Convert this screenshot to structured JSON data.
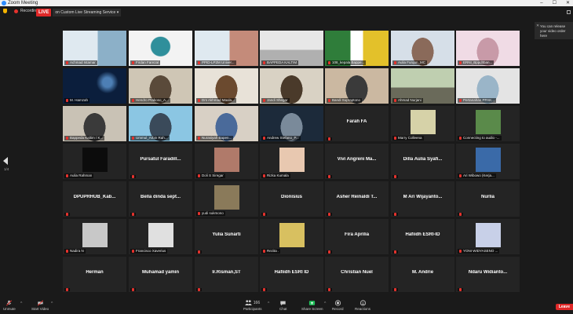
{
  "window": {
    "title": "Zoom Meeting",
    "min": "–",
    "max": "☐",
    "close": "✕"
  },
  "topbar": {
    "recording": "Recording",
    "live_badge": "LIVE",
    "live_service": "on Custom Live Streaming Service ▾"
  },
  "toast": {
    "close": "✕",
    "message": "You can release your video order here"
  },
  "pagination": {
    "indicator": "1/4"
  },
  "colors": {
    "active_speaker": "#b9e34a",
    "live": "#e02828",
    "tile_bg": "#242424",
    "share_green": "#21c35b"
  },
  "tiles": [
    {
      "label": "Achmad Istamar",
      "video": "slide",
      "c1": "#dfe9f0",
      "c2": "#8cb0c8",
      "active": true
    },
    {
      "label": "Firdan Farezal",
      "video": "logo",
      "c1": "#f3f3f3",
      "c2": "#2f8f9b"
    },
    {
      "label": "PPID-LP2M Univer...",
      "video": "slide",
      "c1": "#dfe9f0",
      "c2": "#c48b7a"
    },
    {
      "label": "BAPPEDA KALTIM",
      "video": "room",
      "c1": "#e7e7e7",
      "c2": "#b0b0b0"
    },
    {
      "label": "108_kepala Bappe...",
      "video": "banner",
      "c1": "#2f7d3a",
      "c2": "#e3c12a"
    },
    {
      "label": "Aulia Furqon_MC",
      "video": "person",
      "c1": "#d6dfe8",
      "c2": "#8a6a5a"
    },
    {
      "label": "ERNI_Bppdltban...",
      "video": "person",
      "c1": "#f0dbe5",
      "c2": "#c89aa8"
    },
    {
      "label": "M. Hamzah",
      "video": "space",
      "c1": "#0b1e3c",
      "c2": "#4d7fb5"
    },
    {
      "label": "Hendro Prakoso_A...",
      "video": "person",
      "c1": "#cfc6b5",
      "c2": "#5a4a3a"
    },
    {
      "label": "Drs Akhmad Maula...",
      "video": "person",
      "c1": "#e8e2d8",
      "c2": "#6b4a2f"
    },
    {
      "label": "Jandi Shegar",
      "video": "person",
      "c1": "#d9d2c4",
      "c2": "#4a3a2a"
    },
    {
      "label": "Bandi Supraptono",
      "video": "person",
      "c1": "#cbb8a1",
      "c2": "#3a3a3a"
    },
    {
      "label": "Ahmad Nurjani",
      "video": "room",
      "c1": "#bfcfb0",
      "c2": "#6a6a5a"
    },
    {
      "label": "Pertanahan PPAK...",
      "video": "person",
      "c1": "#e4e4e4",
      "c2": "#9ab5c8"
    },
    {
      "label": "Bappeda Kaltim / K...",
      "video": "person",
      "c1": "#c9c2b5",
      "c2": "#3a3a3a"
    },
    {
      "label": "Ummul_Arbin Rah...",
      "video": "person",
      "c1": "#8bc6e3",
      "c2": "#3a4a5a"
    },
    {
      "label": "Nurasiyah Bapen...",
      "video": "person",
      "c1": "#d8d0c5",
      "c2": "#4a6a9a"
    },
    {
      "label": "Andrew Stefano_P...",
      "video": "person",
      "c1": "#1c2a3a",
      "c2": "#7a8a9a"
    },
    {
      "label": "",
      "name": "Farah FA"
    },
    {
      "label": "Marry Colleena",
      "thumb": "#d6d2a8"
    },
    {
      "label": "Connecting to audio -...",
      "thumb": "#5a8a4a"
    },
    {
      "label": "Aulia Rahman",
      "thumb": "#0c0c0c"
    },
    {
      "label": "",
      "name": "Pursatul Faradill..."
    },
    {
      "label": "Doli S Siregar",
      "thumb": "#b07a6a"
    },
    {
      "label": "Rizka Kumala",
      "thumb": "#e8c8b0"
    },
    {
      "label": "",
      "name": "Vivi Angreni Ma..."
    },
    {
      "label": "",
      "name": "Dilla Aulia Syafi..."
    },
    {
      "label": "Ari Wibowo (Kerja...",
      "thumb": "#3a6aa8"
    },
    {
      "label": "",
      "name": "DPUPRHUB_Kab..."
    },
    {
      "label": "",
      "name": "Bella dinda sept..."
    },
    {
      "label": "yudi sukmono",
      "thumb": "#8a7a5a"
    },
    {
      "label": "",
      "name": "Dionisius"
    },
    {
      "label": "",
      "name": "Asher Reinaldi T..."
    },
    {
      "label": "",
      "name": "M Ari Wijayanto..."
    },
    {
      "label": "",
      "name": "Nurlia"
    },
    {
      "label": "Nadira N",
      "thumb": "#c8c8c8"
    },
    {
      "label": "Francisco Xaverius",
      "thumb": "#e0e0e0"
    },
    {
      "label": "",
      "name": "Yulia Sunarti"
    },
    {
      "label": "Rezita .",
      "thumb": "#d8c060"
    },
    {
      "label": "",
      "name": "Fira Aprilia"
    },
    {
      "label": "",
      "name": "Hafiidh ESRI-ID"
    },
    {
      "label": "YONI WIDYASENO ...",
      "thumb": "#c8d0e8"
    },
    {
      "label": "",
      "name": "Herman"
    },
    {
      "label": "",
      "name": "Muhamad yamin"
    },
    {
      "label": "",
      "name": "Ir.Risman,ST"
    },
    {
      "label": "",
      "name": "Hafiidh ESRI ID"
    },
    {
      "label": "",
      "name": "Christian Nuel"
    },
    {
      "label": "",
      "name": "M. Andrie"
    },
    {
      "label": "",
      "name": "Ndaru Widianto..."
    }
  ],
  "toolbar": {
    "unmute": "Unmute",
    "start_video": "Start Video",
    "participants": "Participants",
    "participants_count": "166",
    "chat": "Chat",
    "share_screen": "Share Screen",
    "record": "Record",
    "reactions": "Reactions",
    "leave": "Leave",
    "caret": "^"
  }
}
